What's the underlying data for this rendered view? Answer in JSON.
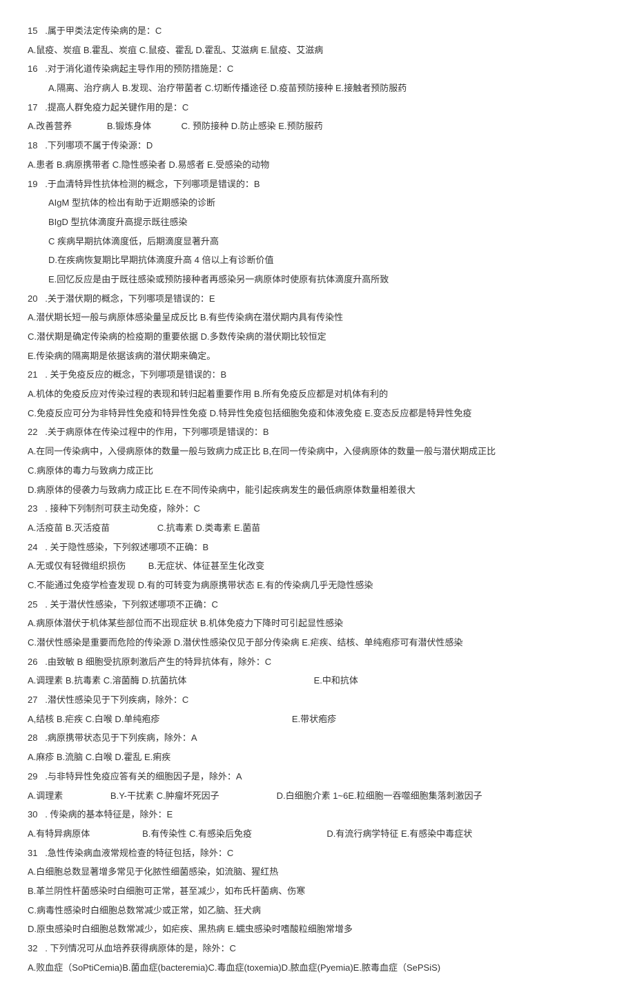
{
  "lines": [
    {
      "text": "15   .属于甲类法定传染病的是：C",
      "indent": false
    },
    {
      "text": "A.鼠疫、炭疽 B.霍乱、炭疽 C.鼠疫、霍乱 D.霍乱、艾滋病 E.鼠疫、艾滋病",
      "indent": false
    },
    {
      "text": "16   .对于消化道传染病起主导作用的预防措施是：C",
      "indent": false
    },
    {
      "text": "A.隔离、治疗病人 B.发现、治疗带菌者 C.切断传播途径 D.疫苗预防接种 E.接触者预防服药",
      "indent": true
    },
    {
      "text": "17   .提高人群免疫力起关键作用的是：C",
      "indent": false
    },
    {
      "text": "A.改善营养              B.锻炼身体            C. 预防接种 D.防止感染 E.预防服药",
      "indent": false
    },
    {
      "text": "",
      "indent": false
    },
    {
      "text": "18   .下列哪项不属于传染源：D",
      "indent": false
    },
    {
      "text": "A.患者 B.病原携带者 C.隐性感染者 D.易感者 E.受感染的动物",
      "indent": false
    },
    {
      "text": "19   .于血清特异性抗体检测的概念，下列哪项是错误的：B",
      "indent": false
    },
    {
      "text": "AIgM 型抗体的检出有助于近期感染的诊断",
      "indent": true
    },
    {
      "text": "BIgD 型抗体滴度升高提示既往感染",
      "indent": true
    },
    {
      "text": "C 疾病早期抗体滴度低，后期滴度显著升高",
      "indent": true
    },
    {
      "text": "D.在疾病恢复期比早期抗体滴度升高 4 倍以上有诊断价值",
      "indent": true
    },
    {
      "text": "E.回忆反应是由于既往感染或预防接种者再感染另一病原体时使原有抗体滴度升高所致",
      "indent": true
    },
    {
      "text": "20   .关于潜伏期的概念，下列哪项是错误的：E",
      "indent": false
    },
    {
      "text": "A.潜伏期长短一般与病原体感染量呈成反比 B.有些传染病在潜伏期内具有传染性",
      "indent": false
    },
    {
      "text": "C.潜伏期是确定传染病的检疫期的重要依据 D.多数传染病的潜伏期比较恒定",
      "indent": false
    },
    {
      "text": "E.传染病的隔离期是依据该病的潜伏期来确定。",
      "indent": false
    },
    {
      "text": "21   . 关于免疫反应的概念，下列哪项是错误的：B",
      "indent": false
    },
    {
      "text": "A.机体的免疫反应对传染过程的表现和转归起着重要作用 B.所有免疫反应都是对机体有利的",
      "indent": false
    },
    {
      "text": "C.免疫反应可分为非特异性免疫和特异性免疫 D.特异性免疫包括细胞免疫和体液免疫 E.变态反应都是特异性免疫",
      "indent": false
    },
    {
      "text": "22   .关于病原体在传染过程中的作用，下列哪项是错误的：B",
      "indent": false
    },
    {
      "text": "A.在同一传染病中，入侵病原体的数量一般与致病力成正比 B,在同一传染病中，入侵病原体的数量一般与潜伏期成正比",
      "indent": false
    },
    {
      "text": "C.病原体的毒力与致病力成正比",
      "indent": false
    },
    {
      "text": "D.病原体的侵袭力与致病力成正比 E.在不同传染病中，能引起疾病发生的最低病原体数量相差很大",
      "indent": false
    },
    {
      "text": "23   . 接种下列制剂可获主动免疫，除外：C",
      "indent": false
    },
    {
      "text": "A.活疫苗 B.灭活疫苗                   C.抗毒素 D.类毒素 E.菌苗",
      "indent": false
    },
    {
      "text": "24   . 关于隐性感染，下列叙述哪项不正确：B",
      "indent": false
    },
    {
      "text": "A.无或仅有轻微组织损伤         B.无症状、体征甚至生化改变",
      "indent": false
    },
    {
      "text": "C.不能通过免疫学检查发现 D.有的可转变为病原携带状态 E.有的传染病几乎无隐性感染",
      "indent": false
    },
    {
      "text": "25   . 关于潜伏性感染，下列叙述哪项不正确：C",
      "indent": false
    },
    {
      "text": "A.病原体潜伏于机体某些部位而不出现症状 B.机体免疫力下降时可引起显性感染",
      "indent": false
    },
    {
      "text": "C.潜伏性感染是重要而危险的传染源 D.潜伏性感染仅见于部分传染病 E.疟疾、结核、单纯疱疹可有潜伏性感染",
      "indent": false
    },
    {
      "text": "26   .由致敏 B 细胞受抗原刺激后产生的特异抗体有，除外：C",
      "indent": false
    },
    {
      "text": "A.调理素 B.抗毒素 C.溶菌酶 D.抗菌抗体                                                   E.中和抗体",
      "indent": false
    },
    {
      "text": "27   .潜伏性感染见于下列疾病，除外：C",
      "indent": false
    },
    {
      "text": "A,结核 B.疟疾 C.白喉 D.单纯疱疹                                                     E.带状疱疹",
      "indent": false
    },
    {
      "text": "28   .病原携带状态见于下列疾病，除外：A",
      "indent": false
    },
    {
      "text": "A.麻疹 B.流脑 C.白喉 D.霍乱 E.痢疾",
      "indent": false
    },
    {
      "text": "29   .与非特异性免疫应答有关的细胞因子是，除外：A",
      "indent": false
    },
    {
      "text": "A.调理素                   B.Y-干扰素 C.肿瘤坏死因子                       D.白细胞介素 1~6E.粒细胞一吞噬细胞集落刺激因子",
      "indent": false
    },
    {
      "text": "30   . 传染病的基本特征是，除外：E",
      "indent": false
    },
    {
      "text": "A.有特异病原体                     B.有传染性 C.有感染后免疫                              D.有流行病学特征 E.有感染中毒症状",
      "indent": false
    },
    {
      "text": "31   .急性传染病血液常规检查的特征包括，除外：C",
      "indent": false
    },
    {
      "text": "A.白细胞总数显著增多常见于化脓性细菌感染，如流脑、猩红热",
      "indent": false
    },
    {
      "text": "B.革兰阴性杆菌感染时白细胞可正常，甚至减少，如布氏杆菌病、伤寒",
      "indent": false
    },
    {
      "text": "C.病毒性感染时白细胞总数常减少或正常，如乙脑、狂犬病",
      "indent": false
    },
    {
      "text": "D.原虫感染时白细胞总数常减少，如疟疾、黑热病 E.蠕虫感染时嗜酸粒细胞常增多",
      "indent": false
    },
    {
      "text": "32   . 下列情况可从血培养获得病原体的是，除外：C",
      "indent": false
    },
    {
      "text": "A.败血症（SoPtiCemia)B.菌血症(bacteremia)C.毒血症(toxemia)D.脓血症(Pyemia)E.脓毒血症（SePSiS)",
      "indent": false
    }
  ]
}
